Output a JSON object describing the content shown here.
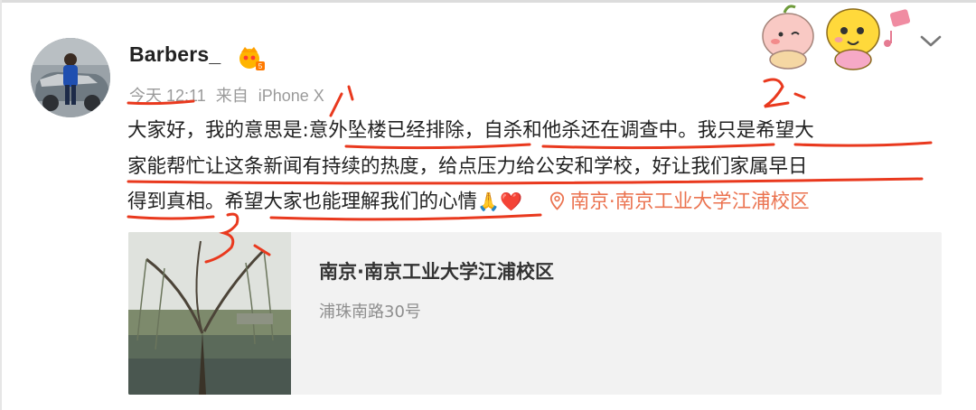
{
  "user": {
    "name": "Barbers_"
  },
  "meta": {
    "time": "今天 12:11",
    "source_prefix": "来自",
    "source": "iPhone X"
  },
  "post": {
    "segments": [
      "大家好，我的意思是:",
      "意外坠楼已经排除，",
      "自杀和他杀还在调查中。",
      "我只是希望大",
      "家能帮忙让这条新闻有持续的热度，给点压力给公安和学校，好让我们家属早日",
      "得到真相。",
      "希望大家也能理解我们的心情"
    ],
    "emoji": [
      "🙏",
      "❤️"
    ],
    "location_tag": "南京·南京工业大学江浦校区"
  },
  "location_card": {
    "title": "南京·南京工业大学江浦校区",
    "address": "浦珠南路30号"
  },
  "annotations": {
    "marks": [
      "1.",
      "2.",
      "3."
    ],
    "color": "#e9391e"
  },
  "colors": {
    "link": "#eb7350",
    "meta": "#9a9a9a",
    "card_bg": "#f2f2f2"
  },
  "icons": [
    "vip-crown-icon",
    "chevron-down-icon",
    "location-pin-icon"
  ]
}
